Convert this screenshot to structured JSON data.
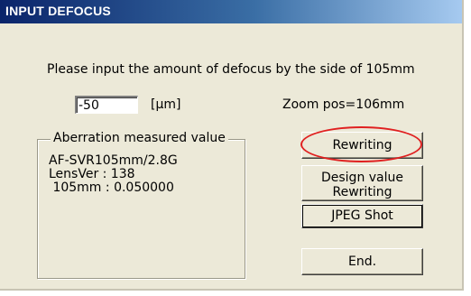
{
  "window": {
    "title": "INPUT DEFOCUS"
  },
  "instruction": "Please input the amount of defocus by the side of  105mm",
  "defocus_input": {
    "value": "-50"
  },
  "unit_label": "[µm]",
  "zoom_label": "Zoom pos=106mm",
  "aberration_group": {
    "legend": "Aberration measured value",
    "lines": [
      "AF-SVR105mm/2.8G",
      "LensVer : 138",
      " 105mm : 0.050000"
    ]
  },
  "buttons": {
    "rewriting": "Rewriting",
    "design_value_line1": "Design value",
    "design_value_line2": "Rewriting",
    "jpeg_shot": "JPEG Shot",
    "end": "End."
  },
  "colors": {
    "highlight_ellipse": "#e02020",
    "title_bar": "#0a246a"
  }
}
